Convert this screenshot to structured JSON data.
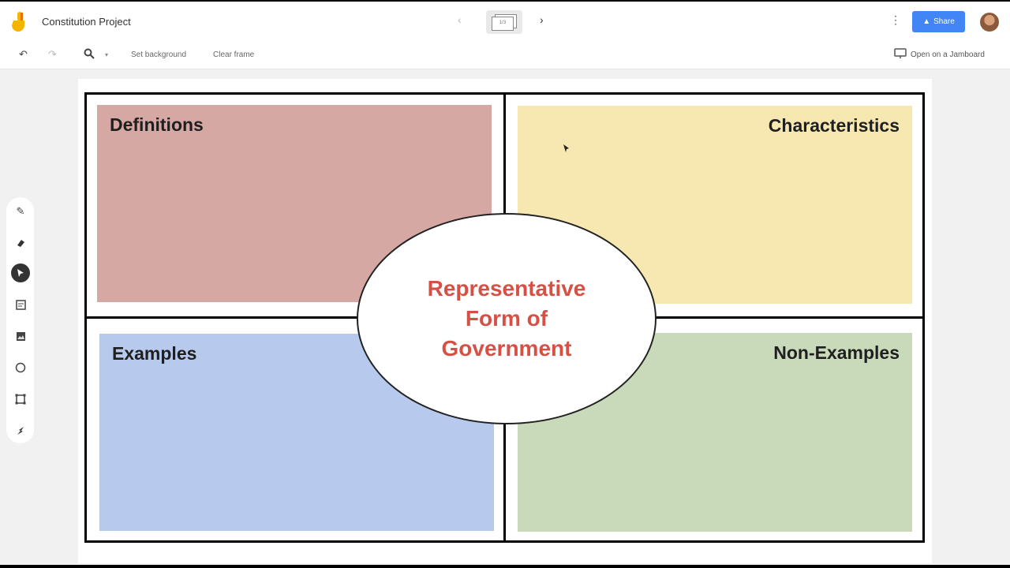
{
  "app": {
    "title": "Constitution Project",
    "share_label": "Share",
    "frame_thumb_label": "1/3"
  },
  "toolbar": {
    "set_background": "Set background",
    "clear_frame": "Clear frame",
    "open_in_jamboard": "Open on a Jamboard"
  },
  "side_tools": [
    "pen",
    "eraser",
    "select",
    "sticky-note",
    "image",
    "circle",
    "text-box",
    "laser"
  ],
  "board": {
    "quadrants": {
      "top_left": "Definitions",
      "top_right": "Characteristics",
      "bottom_left": "Examples",
      "bottom_right": "Non-Examples"
    },
    "center": {
      "line1": "Representative",
      "line2": "Form of",
      "line3": "Government"
    }
  },
  "colors": {
    "definitions": "#d5a8a4",
    "characteristics": "#f6e8b0",
    "examples": "#b7c9ec",
    "non_examples": "#c8dab9",
    "center_text": "#d65145",
    "share_button": "#4285f4"
  }
}
